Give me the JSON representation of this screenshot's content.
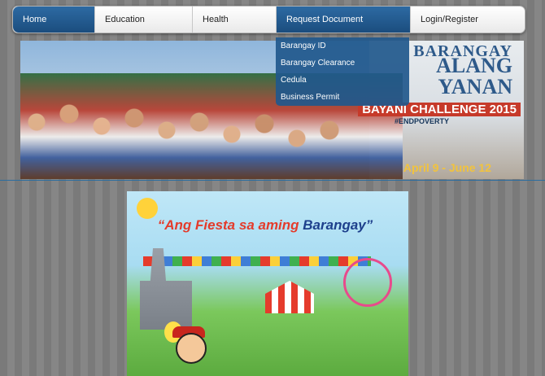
{
  "nav": {
    "items": [
      {
        "label": "Home",
        "state": "active"
      },
      {
        "label": "Education",
        "state": ""
      },
      {
        "label": "Health",
        "state": ""
      },
      {
        "label": "Request Document",
        "state": "open"
      },
      {
        "label": "Login/Register",
        "state": ""
      }
    ]
  },
  "dropdown": {
    "items": [
      "Barangay ID",
      "Barangay Clearance",
      "Cedula",
      "Business Permit"
    ]
  },
  "banner": {
    "line1": "BARANGAY",
    "line2": "ALANG",
    "line3": "YANAN",
    "challenge": "BAYANI CHALLENGE 2015",
    "hashtag": "#ENDPOVERTY",
    "dates": "April 9 - June 12"
  },
  "poster": {
    "title_part1": "“Ang Fiesta sa aming ",
    "title_part2": "Barangay”"
  },
  "colors": {
    "nav_active": "#1f5a91",
    "dropdown_bg": "#21588c",
    "separator": "#2b6da0"
  }
}
